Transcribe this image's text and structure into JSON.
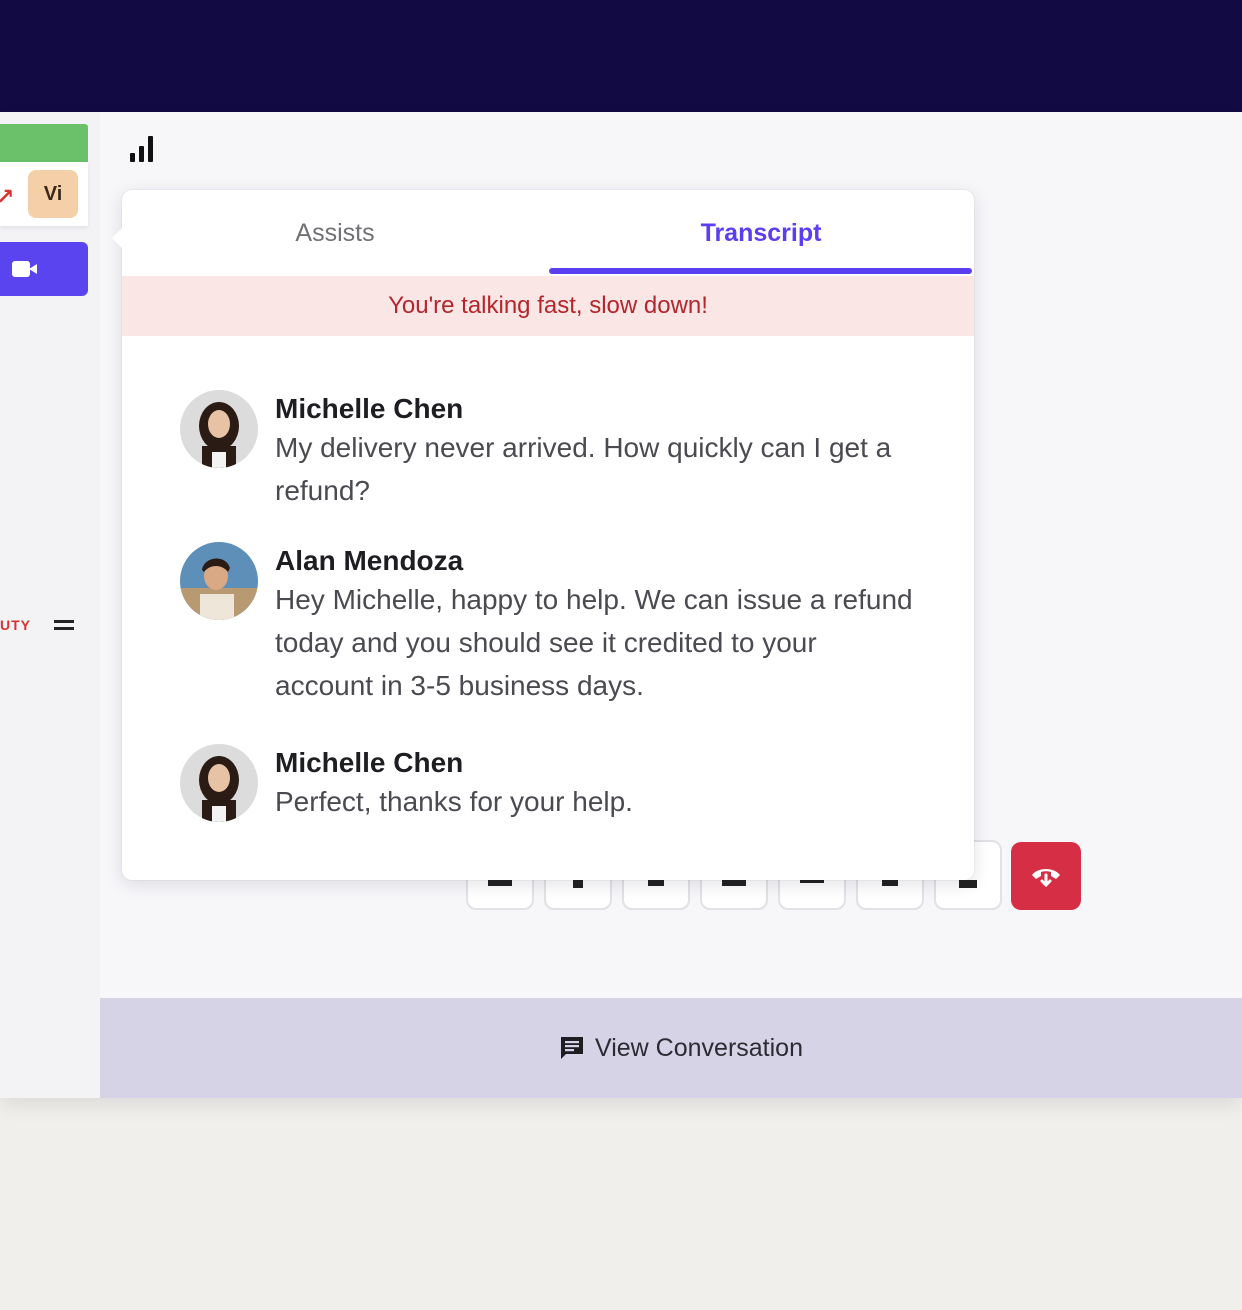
{
  "sidebar": {
    "initials": "Vi",
    "side_label": "UTY"
  },
  "popup": {
    "tabs": [
      {
        "label": "Assists",
        "active": false
      },
      {
        "label": "Transcript",
        "active": true
      }
    ],
    "alert": "You're talking fast, slow down!",
    "messages": [
      {
        "name": "Michelle Chen",
        "text": "My delivery never arrived. How quickly can I get a refund?",
        "avatar": "avatar-woman"
      },
      {
        "name": "Alan Mendoza",
        "text": "Hey Michelle, happy to help. We can issue a refund today and you should see it credited to your account in 3-5 business days.",
        "avatar": "avatar-man"
      },
      {
        "name": "Michelle Chen",
        "text": "Perfect, thanks for your help.",
        "avatar": "avatar-woman"
      }
    ]
  },
  "footer": {
    "label": "View Conversation",
    "icon": "chat-icon"
  },
  "colors": {
    "topbar": "#120a42",
    "accent": "#5a3ff0",
    "alert_bg": "#fbe6e6",
    "alert_text": "#b3262c",
    "end_call": "#d62f45",
    "status_green": "#6bc06a"
  }
}
